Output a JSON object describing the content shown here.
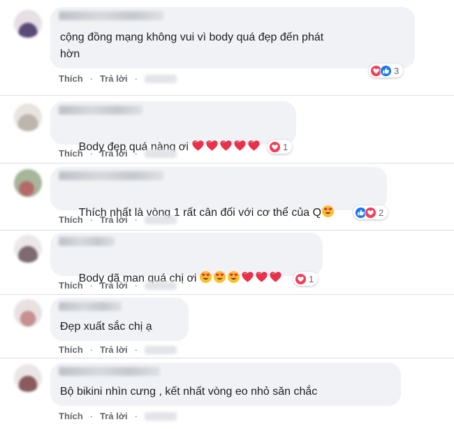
{
  "actions": {
    "like": "Thích",
    "reply": "Trả lời",
    "separator": "·"
  },
  "comments": [
    {
      "text": "cộng đồng mạng không vui vì body quá đẹp đến phát\nhờn",
      "reactions": [
        "heart",
        "like"
      ],
      "reaction_count": "3"
    },
    {
      "text": "Body đẹp quá nàng ơi",
      "emojis": [
        "heart",
        "heart",
        "heart",
        "heart",
        "heart"
      ],
      "reactions": [
        "heart"
      ],
      "reaction_count": "1"
    },
    {
      "text": "Thích nhất là vòng 1 rất cân đối với cơ thể của Q",
      "emojis": [
        "heart-eyes"
      ],
      "reactions": [
        "like",
        "heart"
      ],
      "reaction_count": "2"
    },
    {
      "text": "Body dã man quá chị ơi",
      "emojis": [
        "heart-eyes",
        "heart-eyes",
        "heart-eyes",
        "heart",
        "heart",
        "heart"
      ],
      "reactions": [
        "heart"
      ],
      "reaction_count": "1"
    },
    {
      "text": "Đẹp xuất sắc chị ạ"
    },
    {
      "text": "Bộ bikini nhìn cưng , kết nhất vòng eo nhỏ săn chắc"
    }
  ],
  "colors": {
    "bubble": "#f0f2f5",
    "heart": "#f33e58",
    "like": "#1877f2",
    "meta": "#65676b"
  }
}
